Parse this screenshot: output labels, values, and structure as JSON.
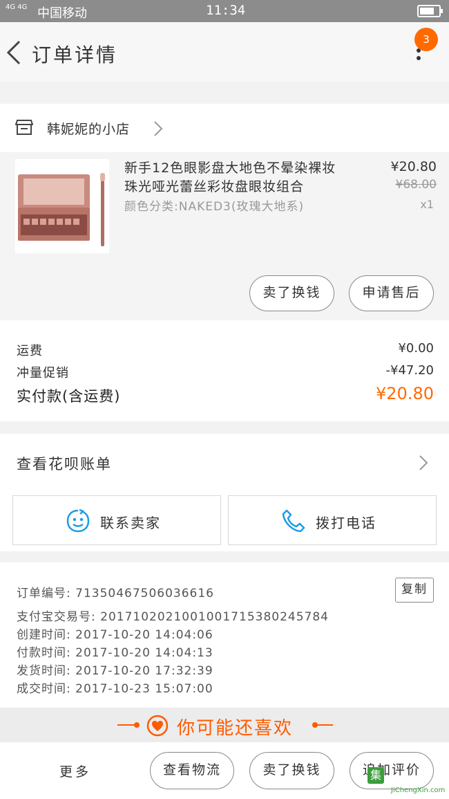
{
  "status_bar": {
    "network": "4G 4G",
    "carrier": "中国移动",
    "time": "11:34",
    "battery_level": 0.75
  },
  "header": {
    "title": "订单详情",
    "badge_count": "3"
  },
  "shop": {
    "name": "韩妮妮的小店"
  },
  "product": {
    "title": "新手12色眼影盘大地色不晕染裸妆珠光哑光蕾丝彩妆盘眼妆组合",
    "variant": "颜色分类:NAKED3(玫瑰大地系)",
    "price": "¥20.80",
    "original_price": "¥68.00",
    "quantity": "x1",
    "buttons": {
      "refund": "卖了换钱",
      "after_sale": "申请售后"
    }
  },
  "fees": {
    "shipping_label": "运费",
    "shipping_value": "¥0.00",
    "promo_label": "冲量促销",
    "promo_value": "-¥47.20",
    "total_label": "实付款(含运费)",
    "total_value": "¥20.80"
  },
  "huabei": {
    "label": "查看花呗账单"
  },
  "contact": {
    "seller_label": "联系卖家",
    "call_label": "拨打电话"
  },
  "order_info": {
    "order_no": "订单编号: 71350467506036616",
    "copy_label": "复制",
    "alipay_no": "支付宝交易号: 2017102021001001715380245784",
    "created": "创建时间: 2017-10-20 14:04:06",
    "paid": "付款时间: 2017-10-20 14:04:13",
    "shipped": "发货时间: 2017-10-20 17:32:39",
    "completed": "成交时间: 2017-10-23 15:07:00"
  },
  "recommend": {
    "title": "你可能还喜欢"
  },
  "bottom_bar": {
    "more": "更多",
    "logistics": "查看物流",
    "resell": "卖了换钱",
    "review": "追加评价"
  },
  "watermark": {
    "badge": "集",
    "site": "JiChengXin.com"
  },
  "colors": {
    "accent": "#ff6a00",
    "icon_blue": "#1e9be8",
    "watermark_green": "#3b9d3b"
  }
}
